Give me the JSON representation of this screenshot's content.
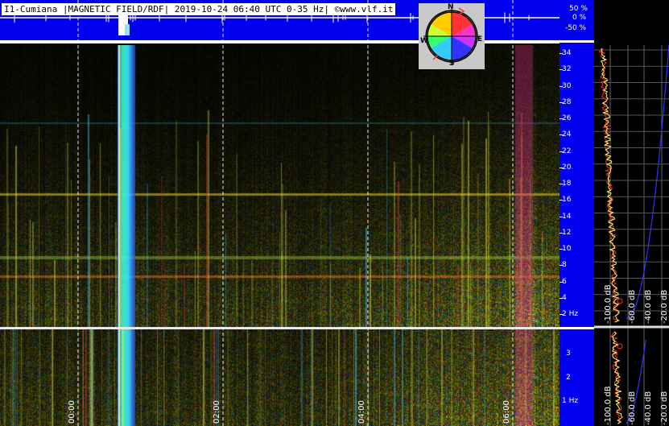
{
  "header": {
    "title": "I1-Cumiana |MAGNETIC FIELD/RDF| 2019-10-24 06:40 UTC 0-35 Hz| ©www.vlf.it"
  },
  "top_scale": [
    "50 %",
    "0 %",
    "-50 %"
  ],
  "freq_axis_main": [
    "34",
    "32",
    "30",
    "28",
    "26",
    "24",
    "22",
    "20",
    "18",
    "16",
    "14",
    "12",
    "10",
    "8",
    "6",
    "4",
    "2 Hz"
  ],
  "freq_axis_zoom": [
    "3",
    "2",
    "1 Hz"
  ],
  "time_labels": [
    "00:00",
    "02:00",
    "04:00",
    "06:00"
  ],
  "db_labels": [
    "-100.0 dB",
    "-60.0 dB",
    "-40.0 dB",
    "-20.0 dB"
  ],
  "compass": {
    "n": "N",
    "s": "S",
    "e": "E",
    "w": "W"
  },
  "colors": {
    "band_blue": "#0000ee",
    "grid": "#ffffff",
    "trace_yellow": "#ffff66",
    "trace_red": "#ff3333"
  }
}
